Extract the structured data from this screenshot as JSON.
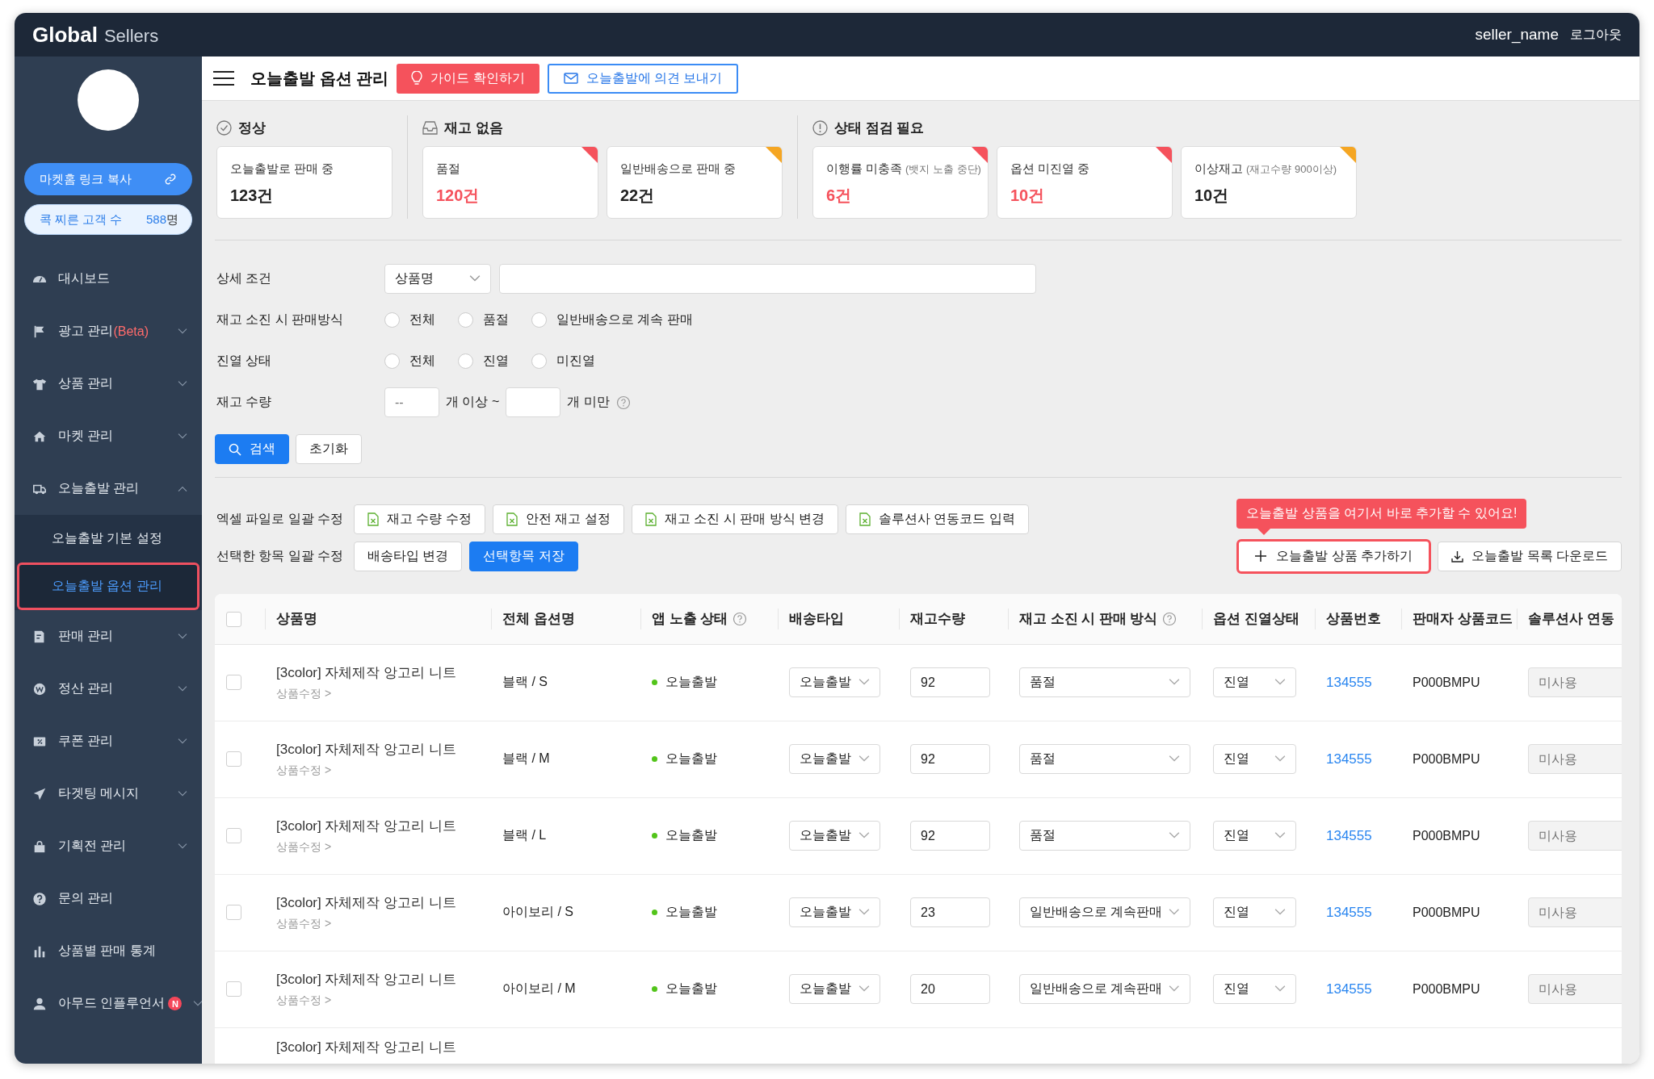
{
  "topbar": {
    "brand_bold": "Global",
    "brand_light": "Sellers",
    "user": "seller_name",
    "logout": "로그아웃"
  },
  "sidebar": {
    "link_button": "마켓홈 링크 복사",
    "poke": {
      "label": "콕 찌른 고객 수",
      "count": "588",
      "unit": "명"
    },
    "items": [
      {
        "label": "대시보드",
        "kind": "link"
      },
      {
        "label": "광고 관리",
        "note": "(Beta)",
        "kind": "group",
        "expanded": false
      },
      {
        "label": "상품 관리",
        "kind": "group",
        "expanded": false
      },
      {
        "label": "마켓 관리",
        "kind": "group",
        "expanded": false
      },
      {
        "label": "오늘출발 관리",
        "kind": "group",
        "expanded": true,
        "children": [
          {
            "label": "오늘출발 기본 설정",
            "selected": false,
            "highlighted": false
          },
          {
            "label": "오늘출발 옵션 관리",
            "selected": true,
            "highlighted": true
          }
        ]
      },
      {
        "label": "판매 관리",
        "kind": "group",
        "expanded": false
      },
      {
        "label": "정산 관리",
        "kind": "group",
        "expanded": false
      },
      {
        "label": "쿠폰 관리",
        "kind": "group",
        "expanded": false
      },
      {
        "label": "타겟팅 메시지",
        "kind": "group",
        "expanded": false
      },
      {
        "label": "기획전 관리",
        "kind": "group",
        "expanded": false
      },
      {
        "label": "문의 관리",
        "kind": "link"
      },
      {
        "label": "상품별 판매 통계",
        "kind": "link"
      },
      {
        "label": "아무드 인플루언서",
        "kind": "group",
        "expanded": false,
        "badge": "N"
      }
    ]
  },
  "page": {
    "title": "오늘출발 옵션 관리",
    "guide_button": "가이드 확인하기",
    "feedback_button": "오늘출발에 의견 보내기"
  },
  "summary": [
    {
      "title": "정상",
      "cards": [
        {
          "label": "오늘출발로 판매 중",
          "value": "123건",
          "value_alert": false
        }
      ]
    },
    {
      "title": "재고 없음",
      "cards": [
        {
          "label": "품절",
          "value": "120건",
          "value_alert": true,
          "color": "#f5525c"
        },
        {
          "label": "일반배송으로 판매 중",
          "value": "22건",
          "value_alert": false,
          "color": "#f5a623"
        }
      ]
    },
    {
      "title": "상태 점검 필요",
      "cards": [
        {
          "label": "이행률 미충족",
          "note": "(뱃지 노출 중단)",
          "value": "6건",
          "value_alert": true,
          "color": "#f5525c"
        },
        {
          "label": "옵션 미진열 중",
          "value": "10건",
          "value_alert": true,
          "color": "#f5525c"
        },
        {
          "label": "이상재고",
          "note": "(재고수량 900이상)",
          "value": "10건",
          "value_alert": false,
          "color": "#f5a623"
        }
      ]
    }
  ],
  "filters": {
    "rows": [
      {
        "label": "상세 조건",
        "kind": "search",
        "select": "상품명"
      },
      {
        "label": "재고 소진 시 판매방식",
        "kind": "radio",
        "options": [
          {
            "label": "전체",
            "selected": false
          },
          {
            "label": "품절",
            "selected": false
          },
          {
            "label": "일반배송으로 계속 판매",
            "selected": false
          }
        ]
      },
      {
        "label": "진열 상태",
        "kind": "radio",
        "options": [
          {
            "label": "전체",
            "selected": false
          },
          {
            "label": "진열",
            "selected": false
          },
          {
            "label": "미진열",
            "selected": false
          }
        ]
      },
      {
        "label": "재고 수량",
        "kind": "range",
        "min_placeholder": "--",
        "min_unit": "개 이상 ~",
        "max_unit": "개 미만"
      }
    ],
    "search_button": "검색",
    "reset_button": "초기화"
  },
  "bulk": {
    "excel": {
      "label": "엑셀 파일로 일괄 수정",
      "buttons": [
        "재고 수량 수정",
        "안전 재고 설정",
        "재고 소진 시 판매 방식 변경",
        "솔루션사 연동코드 입력"
      ]
    },
    "selected": {
      "label": "선택한 항목 일괄 수정",
      "buttons": [
        {
          "label": "배송타입 변경",
          "primary": false
        },
        {
          "label": "선택항목 저장",
          "primary": true
        }
      ]
    },
    "tooltip": "오늘출발 상품을 여기서 바로 추가할 수 있어요!",
    "add_button": {
      "label": "오늘출발 상품 추가하기",
      "highlighted": true
    },
    "download_button": "오늘출발 목록 다운로드"
  },
  "table": {
    "select_all": {
      "checked": false
    },
    "columns": [
      {
        "label": "상품명"
      },
      {
        "label": "전체 옵션명"
      },
      {
        "label": "앱 노출 상태",
        "help": true
      },
      {
        "label": "배송타입"
      },
      {
        "label": "재고수량"
      },
      {
        "label": "재고 소진 시 판매 방식",
        "help": true
      },
      {
        "label": "옵션 진열상태"
      },
      {
        "label": "상품번호"
      },
      {
        "label": "판매자 상품코드"
      },
      {
        "label": "솔루션사 연동"
      }
    ],
    "rows": [
      {
        "checked": false,
        "name": "[3color] 자체제작 앙고리 니트",
        "edit_link": "상품수정 >",
        "option": "블랙 / S",
        "status": {
          "label": "오늘출발",
          "color": "#52c41a"
        },
        "delivery": "오늘출발",
        "stock": "92",
        "soldout_mode": "품절",
        "display": "진열",
        "product_no": "134555",
        "seller_code": "P000BMPU",
        "solution_placeholder": "미사용"
      },
      {
        "checked": false,
        "name": "[3color] 자체제작 앙고리 니트",
        "edit_link": "상품수정 >",
        "option": "블랙 / M",
        "status": {
          "label": "오늘출발",
          "color": "#52c41a"
        },
        "delivery": "오늘출발",
        "stock": "92",
        "soldout_mode": "품절",
        "display": "진열",
        "product_no": "134555",
        "seller_code": "P000BMPU",
        "solution_placeholder": "미사용"
      },
      {
        "checked": false,
        "name": "[3color] 자체제작 앙고리 니트",
        "edit_link": "상품수정 >",
        "option": "블랙 / L",
        "status": {
          "label": "오늘출발",
          "color": "#52c41a"
        },
        "delivery": "오늘출발",
        "stock": "92",
        "soldout_mode": "품절",
        "display": "진열",
        "product_no": "134555",
        "seller_code": "P000BMPU",
        "solution_placeholder": "미사용"
      },
      {
        "checked": false,
        "name": "[3color] 자체제작 앙고리 니트",
        "edit_link": "상품수정 >",
        "option": "아이보리 / S",
        "status": {
          "label": "오늘출발",
          "color": "#52c41a"
        },
        "delivery": "오늘출발",
        "stock": "23",
        "soldout_mode": "일반배송으로 계속판매",
        "display": "진열",
        "product_no": "134555",
        "seller_code": "P000BMPU",
        "solution_placeholder": "미사용"
      },
      {
        "checked": false,
        "name": "[3color] 자체제작 앙고리 니트",
        "edit_link": "상품수정 >",
        "option": "아이보리 / M",
        "status": {
          "label": "오늘출발",
          "color": "#52c41a"
        },
        "delivery": "오늘출발",
        "stock": "20",
        "soldout_mode": "일반배송으로 계속판매",
        "display": "진열",
        "product_no": "134555",
        "seller_code": "P000BMPU",
        "solution_placeholder": "미사용"
      },
      {
        "name": "[3color] 자체제작 앙고리 니트"
      }
    ]
  }
}
